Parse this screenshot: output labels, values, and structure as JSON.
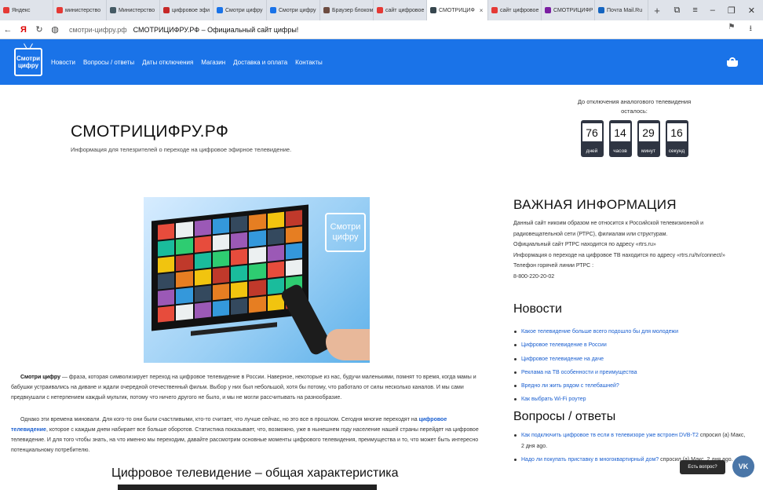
{
  "browser": {
    "tabs": [
      {
        "label": "Яндекс",
        "color": "#e53935"
      },
      {
        "label": "министерство",
        "color": "#e53935"
      },
      {
        "label": "Министерство",
        "color": "#455a64"
      },
      {
        "label": "цифровое эфи",
        "color": "#c62828"
      },
      {
        "label": "Смотри цифру",
        "color": "#1a73e8"
      },
      {
        "label": "Смотри цифру",
        "color": "#1a73e8"
      },
      {
        "label": "Браузер блоком",
        "color": "#6d4c41"
      },
      {
        "label": "сайт цифровое",
        "color": "#e53935"
      },
      {
        "label": "СМОТРИЦИФ",
        "color": "#37474f",
        "active": true
      },
      {
        "label": "сайт цифровое",
        "color": "#e53935"
      },
      {
        "label": "СМОТРИЦИФР",
        "color": "#7b1fa2"
      },
      {
        "label": "Почта Mail.Ru",
        "color": "#1565c0"
      }
    ],
    "new_tab_symbol": "+",
    "window_controls": [
      "⧉",
      "≡",
      "–",
      "❐",
      "✕"
    ],
    "address": {
      "domain": "смотри-цифру.рф",
      "page_title": "СМОТРИЦИФРУ.РФ – Официальный сайт цифры!"
    }
  },
  "header": {
    "logo_text": "Смотри цифру",
    "nav": [
      "Новости",
      "Вопросы / ответы",
      "Даты отключения",
      "Магазин",
      "Доставка и оплата",
      "Контакты"
    ],
    "accent_color": "#1a73e8"
  },
  "hero_text": {
    "title": "СМОТРИЦИФРУ.РФ",
    "subtitle": "Информация для телезрителей о переходе на цифровое эфирное телевидение."
  },
  "countdown": {
    "caption": "До отключения аналогового телевидения осталось:",
    "items": [
      {
        "value": "76",
        "unit": "дней"
      },
      {
        "value": "14",
        "unit": "часов"
      },
      {
        "value": "29",
        "unit": "минут"
      },
      {
        "value": "16",
        "unit": "секунд"
      }
    ]
  },
  "hero_image": {
    "logo_text": "Смотри цифру"
  },
  "article": {
    "p1_bold": "Смотри цифру",
    "p1_rest": " — фраза, которая символизирует переход на цифровое телевидение в России. Наверное, некоторые из нас, будучи маленькими, помнят то время, когда мамы и бабушки устраивались на диване и ждали очередной отечественный фильм. Выбор у них был небольшой, хотя бы потому, что работало от силы несколько каналов. И мы сами предвкушали с нетерпением каждый мультик, потому что ничего другого не было, и мы не могли рассчитывать на разнообразие.",
    "p2_start": "Однако эти времена миновали. Для кого-то они были счастливыми, кто-то считает, что лучше сейчас, но это все в прошлом. Сегодня многие переходят на ",
    "p2_link": "цифровое телевидение",
    "p2_rest": ", которое с каждым днем набирает все больше оборотов. Статистика показывает, что, возможно, уже в нынешнем году население нашей страны перейдет на цифровое телевидение. И для того чтобы знать, на что именно мы переходим, давайте рассмотрим основные моменты цифрового телевидения, преимущества и то, что может быть интересно потенциальному потребителю.",
    "h2": "Цифровое телевидение – общая характеристика"
  },
  "important": {
    "heading": "ВАЖНАЯ ИНФОРМАЦИЯ",
    "lines": [
      "Данный сайт никоим образом не относится к Российской телевизионной и радиовещательной сети (РТРС), филиалам или структурам.",
      "Официальный сайт РТРС находится по адресу «rtrs.ru»",
      "Информация о переходе на цифровое ТВ находится по адресу «rtrs.ru/tv/connect/»",
      "Телефон горячей линии РТРС :",
      "8-800-220-20-02"
    ]
  },
  "news": {
    "heading": "Новости",
    "items": [
      "Какое телевидение больше всего подошло бы для молодежи",
      "Цифровое телевидение в России",
      "Цифровое телевидение на даче",
      "Реклама на ТВ особенности и преимущества",
      "Вредно ли жить рядом с телебашней?",
      "Как выбрать Wi-Fi роутер"
    ]
  },
  "qa": {
    "heading": "Вопросы / ответы",
    "items": [
      {
        "link": "Как подключить цифровое тв если в телевизоре уже встроен DVB-T2",
        "meta": " спросил (а) Макс, 2 дня ago."
      },
      {
        "link": "Надо ли покупать приставку в многоквартирный дом?",
        "meta": " спросил (а) Макс, 2 дня ago."
      }
    ]
  },
  "widgets": {
    "ask_label": "Есть вопрос?",
    "vk_label": "VK"
  }
}
